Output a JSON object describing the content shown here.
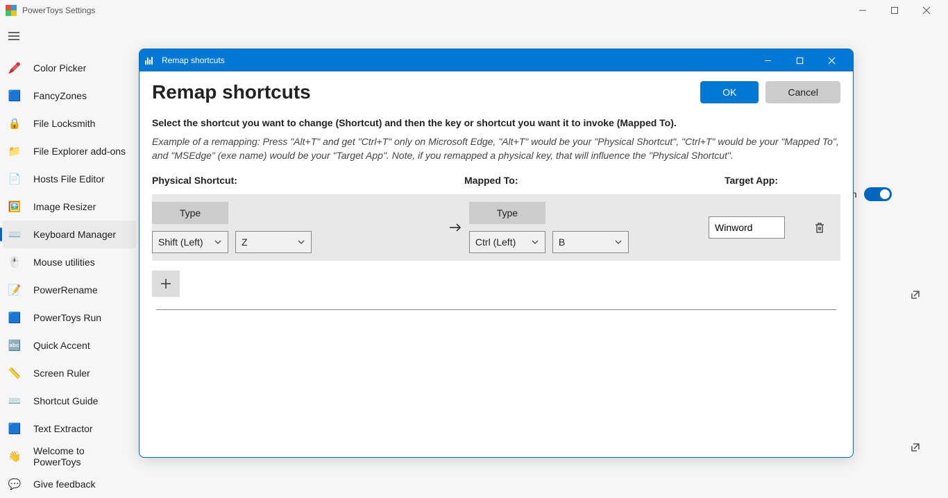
{
  "window": {
    "title": "PowerToys Settings"
  },
  "sidebar": {
    "items": [
      {
        "label": "Color Picker",
        "icon": "🖍️"
      },
      {
        "label": "FancyZones",
        "icon": "🟦"
      },
      {
        "label": "File Locksmith",
        "icon": "🔒"
      },
      {
        "label": "File Explorer add-ons",
        "icon": "📁"
      },
      {
        "label": "Hosts File Editor",
        "icon": "📄"
      },
      {
        "label": "Image Resizer",
        "icon": "🖼️"
      },
      {
        "label": "Keyboard Manager",
        "icon": "⌨️"
      },
      {
        "label": "Mouse utilities",
        "icon": "🖱️"
      },
      {
        "label": "PowerRename",
        "icon": "📝"
      },
      {
        "label": "PowerToys Run",
        "icon": "🟦"
      },
      {
        "label": "Quick Accent",
        "icon": "🔤"
      },
      {
        "label": "Screen Ruler",
        "icon": "📏"
      },
      {
        "label": "Shortcut Guide",
        "icon": "⌨️"
      },
      {
        "label": "Text Extractor",
        "icon": "🟦"
      },
      {
        "label": "Welcome to PowerToys",
        "icon": "👋"
      },
      {
        "label": "Give feedback",
        "icon": "💬"
      }
    ],
    "active_index": 6
  },
  "background": {
    "toggle_label": "On"
  },
  "dialog": {
    "title": "Remap shortcuts",
    "heading": "Remap shortcuts",
    "ok": "OK",
    "cancel": "Cancel",
    "instruction": "Select the shortcut you want to change (Shortcut) and then the key or shortcut you want it to invoke (Mapped To).",
    "example": "Example of a remapping: Press \"Alt+T\" and get \"Ctrl+T\" only on Microsoft Edge, \"Alt+T\" would be your \"Physical Shortcut\", \"Ctrl+T\" would be your \"Mapped To\", and \"MSEdge\" (exe name) would be your \"Target App\". Note, if you remapped a physical key, that will influence the \"Physical Shortcut\".",
    "columns": {
      "physical": "Physical Shortcut:",
      "mapped": "Mapped To:",
      "target": "Target App:"
    },
    "type_label": "Type",
    "row": {
      "physical_key1": "Shift (Left)",
      "physical_key2": "Z",
      "mapped_key1": "Ctrl (Left)",
      "mapped_key2": "B",
      "target_app": "Winword"
    }
  }
}
